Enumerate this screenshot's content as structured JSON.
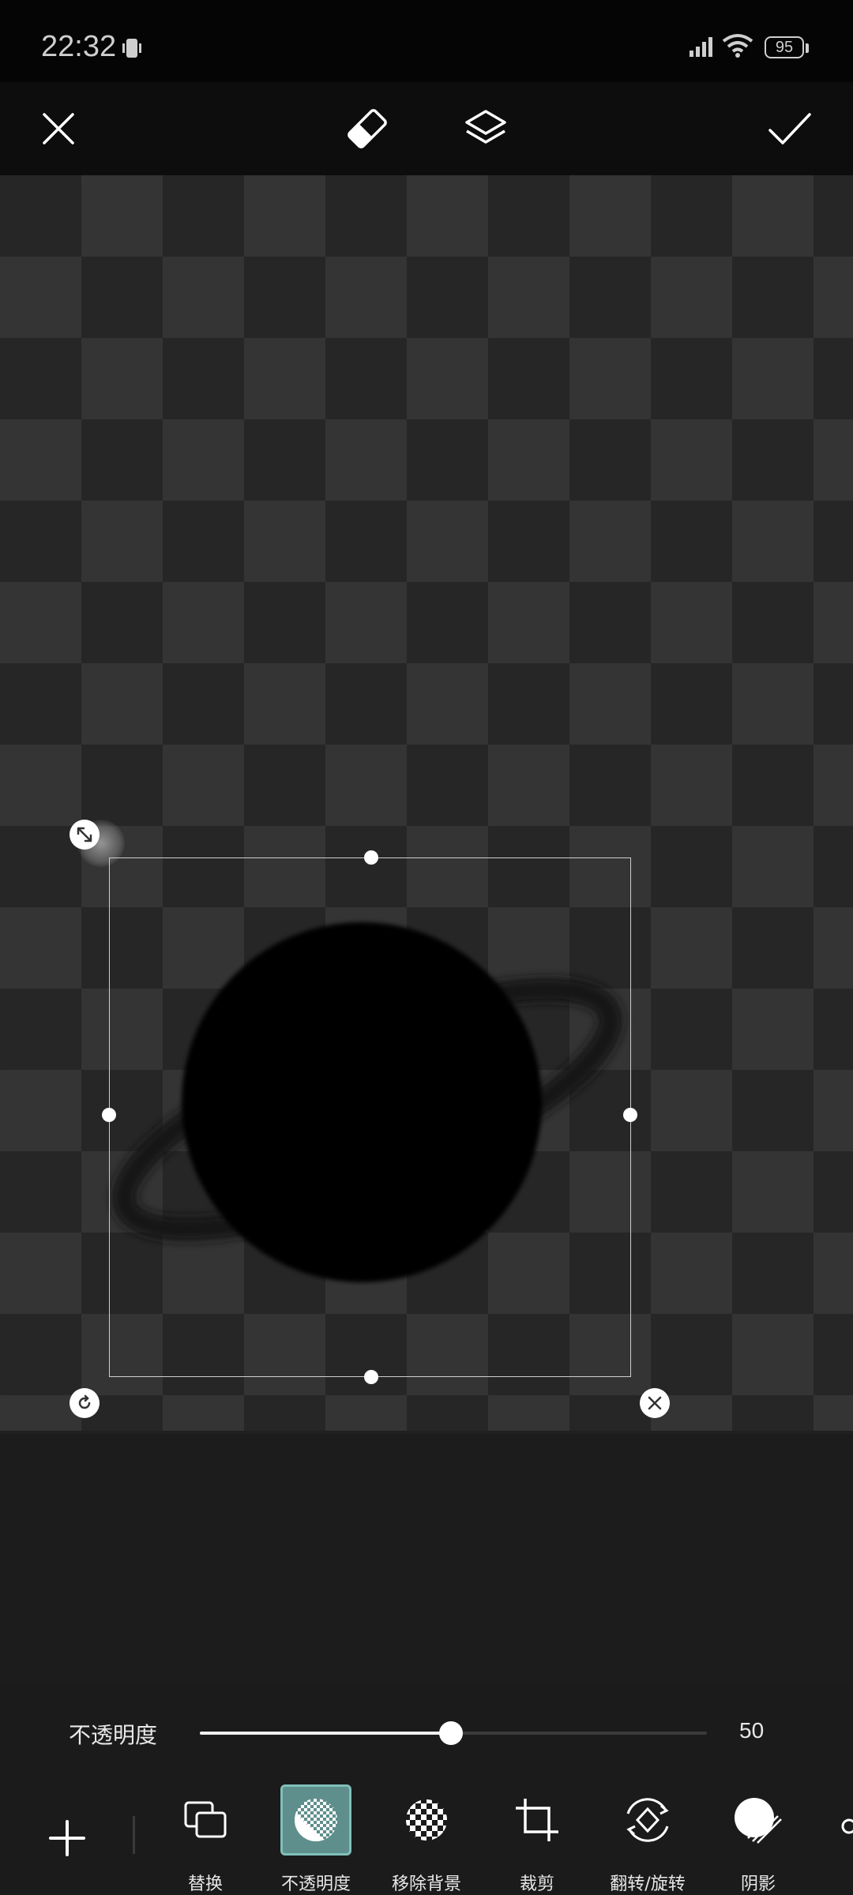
{
  "status_bar": {
    "time": "22:32",
    "battery": "95"
  },
  "opacity_control": {
    "label": "不透明度",
    "value": "50",
    "level_percent": 50
  },
  "tools": {
    "replace": "替换",
    "opacity": "不透明度",
    "remove_bg": "移除背景",
    "crop": "裁剪",
    "flip_rotate": "翻转/旋转",
    "shadow": "阴影"
  },
  "colors": {
    "accent": "#5f8f8c",
    "background": "#1b1b1b"
  },
  "icons": {
    "close": "close-icon",
    "eraser": "eraser-icon",
    "layers": "layers-icon",
    "confirm": "check-icon"
  }
}
